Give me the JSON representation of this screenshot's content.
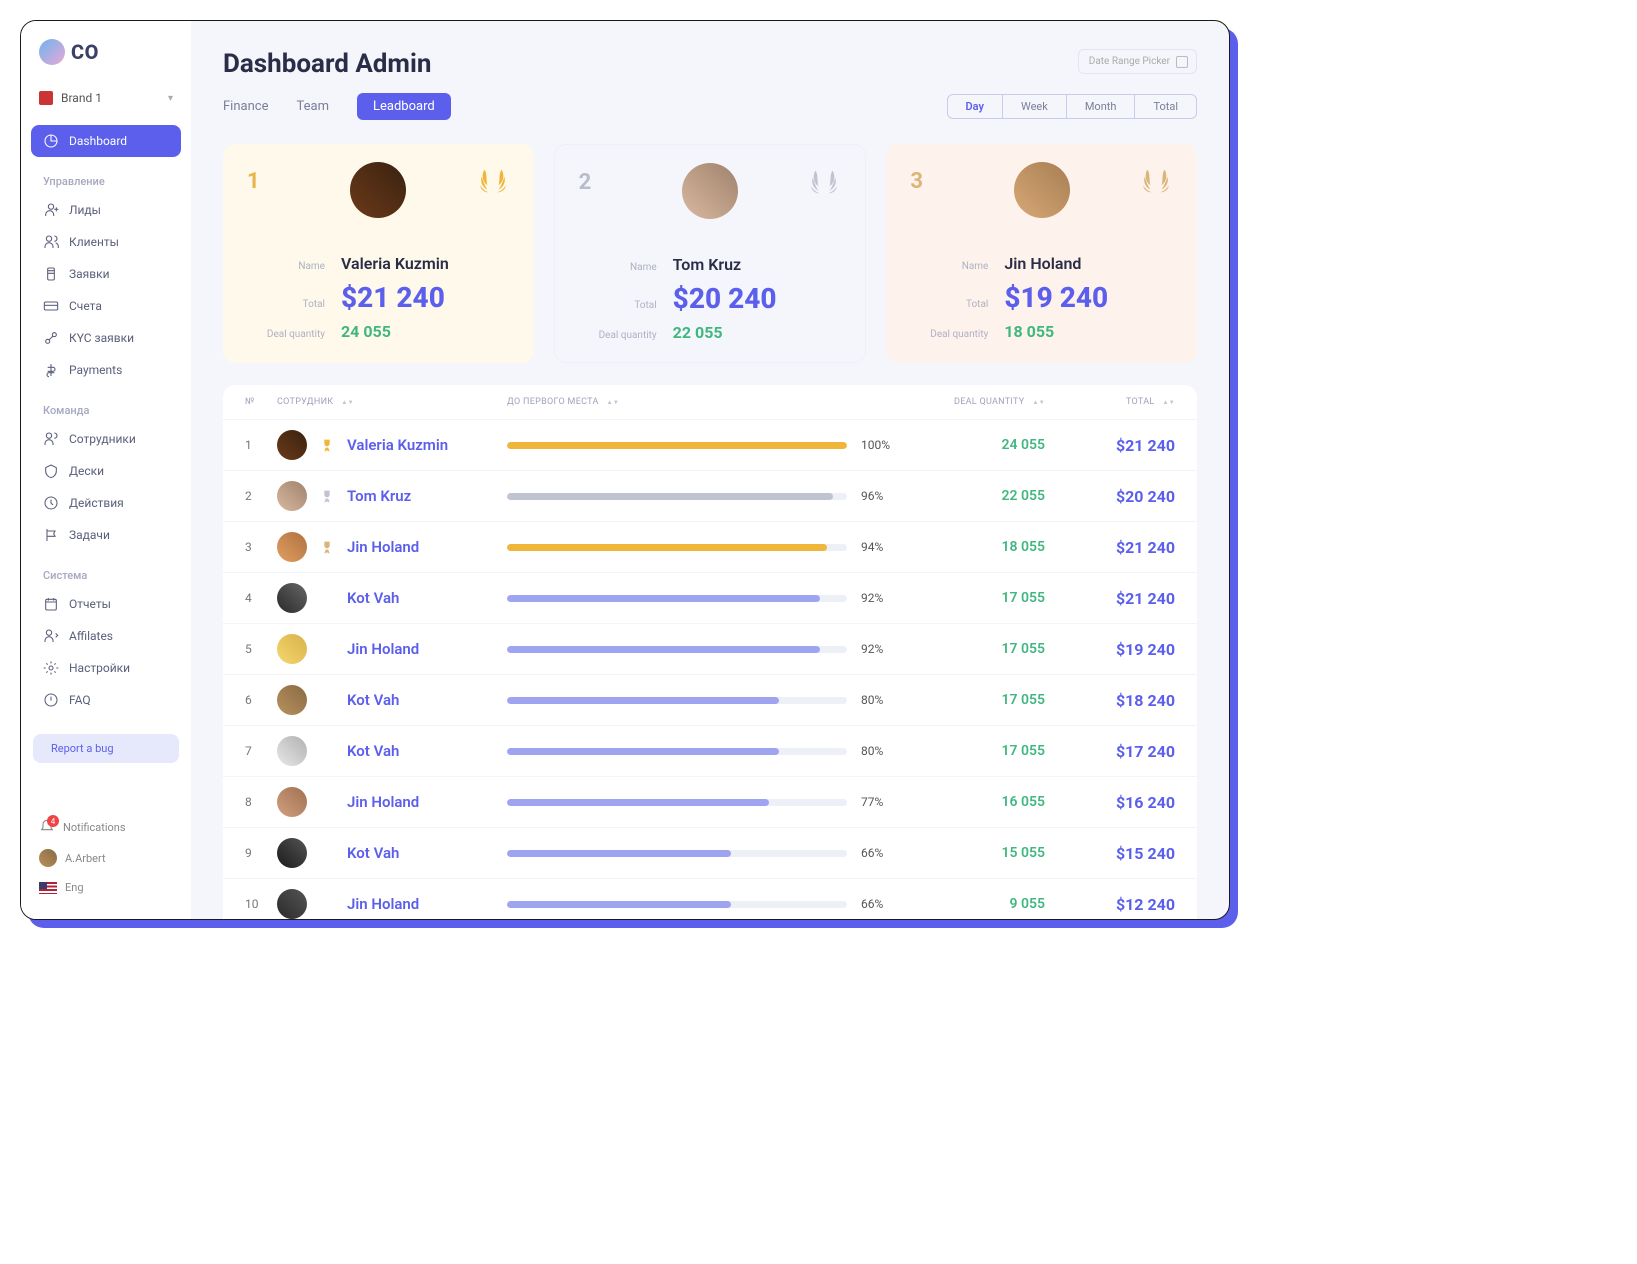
{
  "logo": "CO",
  "brand": {
    "label": "Brand 1"
  },
  "nav": {
    "dashboard": "Dashboard",
    "groups": [
      {
        "heading": "Управление",
        "items": [
          "Лиды",
          "Клиенты",
          "Заявки",
          "Счета",
          "КYC заявки",
          "Payments"
        ]
      },
      {
        "heading": "Команда",
        "items": [
          "Сотрудники",
          "Дески",
          "Действия",
          "Задачи"
        ]
      },
      {
        "heading": "Система",
        "items": [
          "Отчеты",
          "Affilates",
          "Настройки",
          "FAQ"
        ]
      }
    ],
    "report_bug": "Report a bug",
    "notifications": "Notifications",
    "notif_count": "4",
    "user": "A.Arbert",
    "lang": "Eng"
  },
  "header": {
    "title": "Dashboard Admin",
    "date_picker": "Date Range Picker",
    "tabs": [
      "Finance",
      "Team",
      "Leadboard"
    ],
    "active_tab": 2,
    "ranges": [
      "Day",
      "Week",
      "Month",
      "Total"
    ],
    "active_range": 0
  },
  "card_labels": {
    "name": "Name",
    "total": "Total",
    "deal": "Deal quantity"
  },
  "top3": [
    {
      "rank": "1",
      "name": "Valeria Kuzmin",
      "total": "$21 240",
      "deal": "24 055"
    },
    {
      "rank": "2",
      "name": "Tom Kruz",
      "total": "$20 240",
      "deal": "22 055"
    },
    {
      "rank": "3",
      "name": "Jin Holand",
      "total": "$19 240",
      "deal": "18 055"
    }
  ],
  "table": {
    "headers": {
      "rank": "№",
      "employee": "СОТРУДНИК",
      "progress": "ДО ПЕРВОГО МЕСТА",
      "deal": "DEAL QUANTITY",
      "total": "TOTAL"
    },
    "rows": [
      {
        "rank": "1",
        "name": "Valeria Kuzmin",
        "pct": "100%",
        "pctv": 100,
        "color": "#f0b63a",
        "deal": "24 055",
        "total": "$21 240",
        "medal": 1
      },
      {
        "rank": "2",
        "name": "Tom Kruz",
        "pct": "96%",
        "pctv": 96,
        "color": "#c0c3d0",
        "deal": "22 055",
        "total": "$20 240",
        "medal": 2
      },
      {
        "rank": "3",
        "name": "Jin Holand",
        "pct": "94%",
        "pctv": 94,
        "color": "#f0b63a",
        "deal": "18 055",
        "total": "$21 240",
        "medal": 3
      },
      {
        "rank": "4",
        "name": "Kot Vah",
        "pct": "92%",
        "pctv": 92,
        "color": "#9ea4f0",
        "deal": "17 055",
        "total": "$21 240"
      },
      {
        "rank": "5",
        "name": "Jin Holand",
        "pct": "92%",
        "pctv": 92,
        "color": "#9ea4f0",
        "deal": "17 055",
        "total": "$19 240"
      },
      {
        "rank": "6",
        "name": "Kot Vah",
        "pct": "80%",
        "pctv": 80,
        "color": "#9ea4f0",
        "deal": "17 055",
        "total": "$18 240"
      },
      {
        "rank": "7",
        "name": "Kot Vah",
        "pct": "80%",
        "pctv": 80,
        "color": "#9ea4f0",
        "deal": "17 055",
        "total": "$17 240"
      },
      {
        "rank": "8",
        "name": "Jin Holand",
        "pct": "77%",
        "pctv": 77,
        "color": "#9ea4f0",
        "deal": "16 055",
        "total": "$16 240"
      },
      {
        "rank": "9",
        "name": "Kot Vah",
        "pct": "66%",
        "pctv": 66,
        "color": "#9ea4f0",
        "deal": "15 055",
        "total": "$15 240"
      },
      {
        "rank": "10",
        "name": "Jin Holand",
        "pct": "66%",
        "pctv": 66,
        "color": "#9ea4f0",
        "deal": "9 055",
        "total": "$12 240"
      }
    ]
  }
}
